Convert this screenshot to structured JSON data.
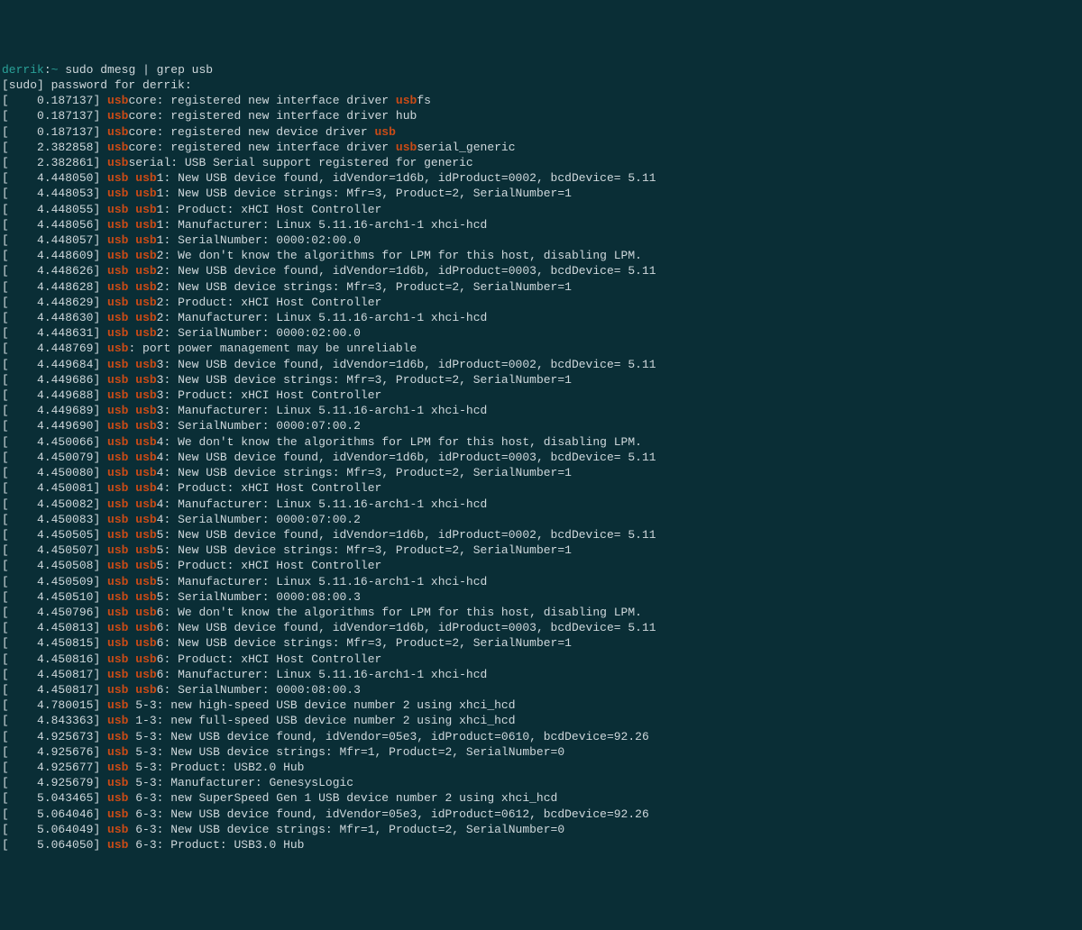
{
  "prompt": {
    "user": "derrik",
    "sep": ":",
    "path": "~",
    "command": "sudo dmesg | grep usb"
  },
  "password_line": "[sudo] password for derrik:",
  "hl": "usb",
  "lines": [
    {
      "ts": "0.187137",
      "pre": "",
      "post": "core: registered new interface driver ",
      "post2": "fs"
    },
    {
      "ts": "0.187137",
      "pre": "",
      "post": "core: registered new interface driver hub"
    },
    {
      "ts": "0.187137",
      "pre": "",
      "post": "core: registered new device driver ",
      "post2": ""
    },
    {
      "ts": "2.382858",
      "pre": "",
      "post": "core: registered new interface driver ",
      "post2": "serial_generic"
    },
    {
      "ts": "2.382861",
      "pre": "",
      "post": "serial: USB Serial support registered for generic"
    },
    {
      "ts": "4.448050",
      "pre": "",
      "post": " ",
      "post2": "1: New USB device found, idVendor=1d6b, idProduct=0002, bcdDevice= 5.11"
    },
    {
      "ts": "4.448053",
      "pre": "",
      "post": " ",
      "post2": "1: New USB device strings: Mfr=3, Product=2, SerialNumber=1"
    },
    {
      "ts": "4.448055",
      "pre": "",
      "post": " ",
      "post2": "1: Product: xHCI Host Controller"
    },
    {
      "ts": "4.448056",
      "pre": "",
      "post": " ",
      "post2": "1: Manufacturer: Linux 5.11.16-arch1-1 xhci-hcd"
    },
    {
      "ts": "4.448057",
      "pre": "",
      "post": " ",
      "post2": "1: SerialNumber: 0000:02:00.0"
    },
    {
      "ts": "4.448609",
      "pre": "",
      "post": " ",
      "post2": "2: We don't know the algorithms for LPM for this host, disabling LPM."
    },
    {
      "ts": "4.448626",
      "pre": "",
      "post": " ",
      "post2": "2: New USB device found, idVendor=1d6b, idProduct=0003, bcdDevice= 5.11"
    },
    {
      "ts": "4.448628",
      "pre": "",
      "post": " ",
      "post2": "2: New USB device strings: Mfr=3, Product=2, SerialNumber=1"
    },
    {
      "ts": "4.448629",
      "pre": "",
      "post": " ",
      "post2": "2: Product: xHCI Host Controller"
    },
    {
      "ts": "4.448630",
      "pre": "",
      "post": " ",
      "post2": "2: Manufacturer: Linux 5.11.16-arch1-1 xhci-hcd"
    },
    {
      "ts": "4.448631",
      "pre": "",
      "post": " ",
      "post2": "2: SerialNumber: 0000:02:00.0"
    },
    {
      "ts": "4.448769",
      "pre": "",
      "post": ": port power management may be unreliable"
    },
    {
      "ts": "4.449684",
      "pre": "",
      "post": " ",
      "post2": "3: New USB device found, idVendor=1d6b, idProduct=0002, bcdDevice= 5.11"
    },
    {
      "ts": "4.449686",
      "pre": "",
      "post": " ",
      "post2": "3: New USB device strings: Mfr=3, Product=2, SerialNumber=1"
    },
    {
      "ts": "4.449688",
      "pre": "",
      "post": " ",
      "post2": "3: Product: xHCI Host Controller"
    },
    {
      "ts": "4.449689",
      "pre": "",
      "post": " ",
      "post2": "3: Manufacturer: Linux 5.11.16-arch1-1 xhci-hcd"
    },
    {
      "ts": "4.449690",
      "pre": "",
      "post": " ",
      "post2": "3: SerialNumber: 0000:07:00.2"
    },
    {
      "ts": "4.450066",
      "pre": "",
      "post": " ",
      "post2": "4: We don't know the algorithms for LPM for this host, disabling LPM."
    },
    {
      "ts": "4.450079",
      "pre": "",
      "post": " ",
      "post2": "4: New USB device found, idVendor=1d6b, idProduct=0003, bcdDevice= 5.11"
    },
    {
      "ts": "4.450080",
      "pre": "",
      "post": " ",
      "post2": "4: New USB device strings: Mfr=3, Product=2, SerialNumber=1"
    },
    {
      "ts": "4.450081",
      "pre": "",
      "post": " ",
      "post2": "4: Product: xHCI Host Controller"
    },
    {
      "ts": "4.450082",
      "pre": "",
      "post": " ",
      "post2": "4: Manufacturer: Linux 5.11.16-arch1-1 xhci-hcd"
    },
    {
      "ts": "4.450083",
      "pre": "",
      "post": " ",
      "post2": "4: SerialNumber: 0000:07:00.2"
    },
    {
      "ts": "4.450505",
      "pre": "",
      "post": " ",
      "post2": "5: New USB device found, idVendor=1d6b, idProduct=0002, bcdDevice= 5.11"
    },
    {
      "ts": "4.450507",
      "pre": "",
      "post": " ",
      "post2": "5: New USB device strings: Mfr=3, Product=2, SerialNumber=1"
    },
    {
      "ts": "4.450508",
      "pre": "",
      "post": " ",
      "post2": "5: Product: xHCI Host Controller"
    },
    {
      "ts": "4.450509",
      "pre": "",
      "post": " ",
      "post2": "5: Manufacturer: Linux 5.11.16-arch1-1 xhci-hcd"
    },
    {
      "ts": "4.450510",
      "pre": "",
      "post": " ",
      "post2": "5: SerialNumber: 0000:08:00.3"
    },
    {
      "ts": "4.450796",
      "pre": "",
      "post": " ",
      "post2": "6: We don't know the algorithms for LPM for this host, disabling LPM."
    },
    {
      "ts": "4.450813",
      "pre": "",
      "post": " ",
      "post2": "6: New USB device found, idVendor=1d6b, idProduct=0003, bcdDevice= 5.11"
    },
    {
      "ts": "4.450815",
      "pre": "",
      "post": " ",
      "post2": "6: New USB device strings: Mfr=3, Product=2, SerialNumber=1"
    },
    {
      "ts": "4.450816",
      "pre": "",
      "post": " ",
      "post2": "6: Product: xHCI Host Controller"
    },
    {
      "ts": "4.450817",
      "pre": "",
      "post": " ",
      "post2": "6: Manufacturer: Linux 5.11.16-arch1-1 xhci-hcd"
    },
    {
      "ts": "4.450817",
      "pre": "",
      "post": " ",
      "post2": "6: SerialNumber: 0000:08:00.3"
    },
    {
      "ts": "4.780015",
      "pre": "",
      "post": " 5-3: new high-speed USB device number 2 using xhci_hcd"
    },
    {
      "ts": "4.843363",
      "pre": "",
      "post": " 1-3: new full-speed USB device number 2 using xhci_hcd"
    },
    {
      "ts": "4.925673",
      "pre": "",
      "post": " 5-3: New USB device found, idVendor=05e3, idProduct=0610, bcdDevice=92.26"
    },
    {
      "ts": "4.925676",
      "pre": "",
      "post": " 5-3: New USB device strings: Mfr=1, Product=2, SerialNumber=0"
    },
    {
      "ts": "4.925677",
      "pre": "",
      "post": " 5-3: Product: USB2.0 Hub"
    },
    {
      "ts": "4.925679",
      "pre": "",
      "post": " 5-3: Manufacturer: GenesysLogic"
    },
    {
      "ts": "5.043465",
      "pre": "",
      "post": " 6-3: new SuperSpeed Gen 1 USB device number 2 using xhci_hcd"
    },
    {
      "ts": "5.064046",
      "pre": "",
      "post": " 6-3: New USB device found, idVendor=05e3, idProduct=0612, bcdDevice=92.26"
    },
    {
      "ts": "5.064049",
      "pre": "",
      "post": " 6-3: New USB device strings: Mfr=1, Product=2, SerialNumber=0"
    },
    {
      "ts": "5.064050",
      "pre": "",
      "post": " 6-3: Product: USB3.0 Hub"
    }
  ]
}
